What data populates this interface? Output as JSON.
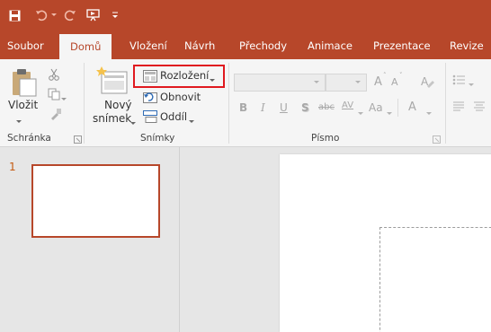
{
  "qat": {
    "icons": [
      "save-icon",
      "undo-icon",
      "redo-icon",
      "start-from-beginning-icon",
      "customize-qat-icon"
    ]
  },
  "tabs": [
    {
      "label": "Soubor"
    },
    {
      "label": "Domů"
    },
    {
      "label": "Vložení"
    },
    {
      "label": "Návrh"
    },
    {
      "label": "Přechody"
    },
    {
      "label": "Animace"
    },
    {
      "label": "Prezentace"
    },
    {
      "label": "Revize"
    }
  ],
  "ribbon": {
    "clipboard": {
      "paste_label": "Vložit",
      "group_label": "Schránka"
    },
    "slides": {
      "new_slide_line1": "Nový",
      "new_slide_line2": "snímek",
      "layout_label": "Rozložení",
      "reset_label": "Obnovit",
      "section_label": "Oddíl",
      "group_label": "Snímky"
    },
    "font": {
      "bold": "B",
      "italic": "I",
      "underline": "U",
      "shadow": "S",
      "strike": "abc",
      "spacing": "AV",
      "change_case": "Aa",
      "font_color": "A",
      "grow": "A",
      "shrink": "A",
      "group_label": "Písmo"
    }
  },
  "thumbnails": {
    "slide_number": "1"
  },
  "colors": {
    "accent": "#b7472a",
    "highlight": "#e0191f"
  }
}
